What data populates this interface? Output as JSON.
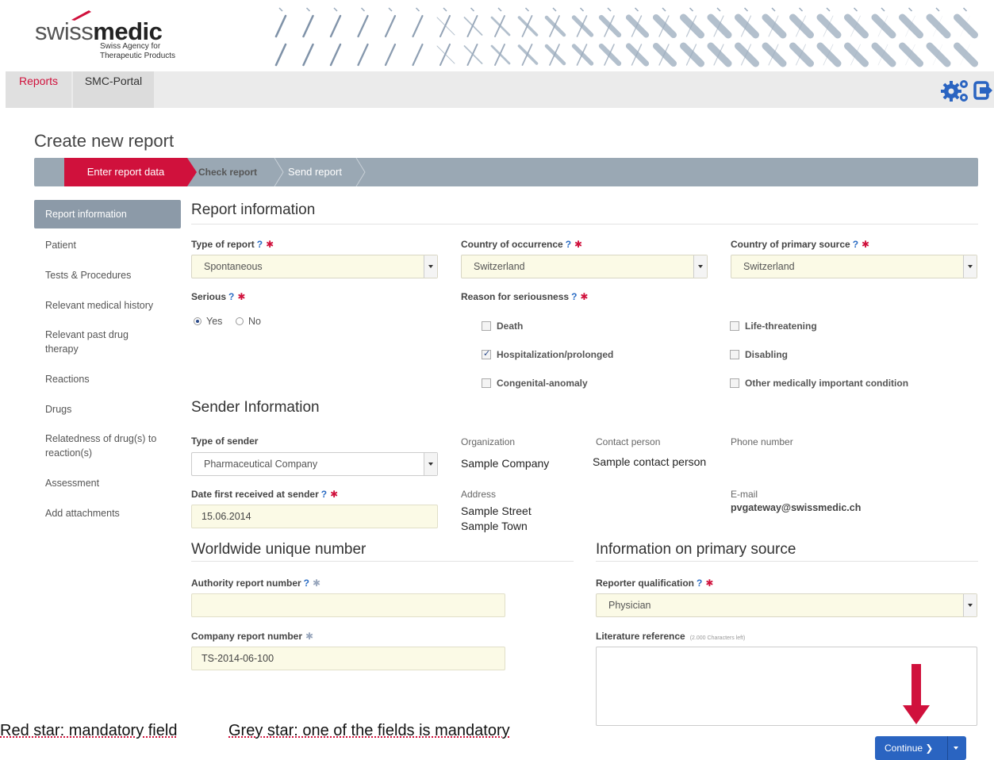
{
  "header": {
    "logo_swiss": "swiss",
    "logo_medic": "medic",
    "logo_sub1": "Swiss Agency for",
    "logo_sub2": "Therapeutic Products",
    "brand_color": "#d0113c"
  },
  "nav": {
    "tabs": [
      {
        "label": "Reports",
        "active": true
      },
      {
        "label": "SMC-Portal",
        "active": false
      }
    ],
    "icons": [
      "gears-icon",
      "logout-icon"
    ]
  },
  "page_title": "Create new report",
  "wizard": {
    "steps": [
      {
        "label": "Enter report data",
        "active": true
      },
      {
        "label": "Check report",
        "active": false
      },
      {
        "label": "Send report",
        "active": false
      }
    ]
  },
  "sidebar": {
    "items": [
      {
        "label": "Report information",
        "active": true
      },
      {
        "label": "Patient"
      },
      {
        "label": "Tests & Procedures"
      },
      {
        "label": "Relevant medical history"
      },
      {
        "label": "Relevant past drug therapy"
      },
      {
        "label": "Reactions"
      },
      {
        "label": "Drugs"
      },
      {
        "label": "Relatedness of drug(s) to reaction(s)"
      },
      {
        "label": "Assessment"
      },
      {
        "label": "Add attachments"
      }
    ]
  },
  "report_info": {
    "title": "Report information",
    "type_of_report_label": "Type of report",
    "type_of_report_value": "Spontaneous",
    "country_occurrence_label": "Country of occurrence",
    "country_occurrence_value": "Switzerland",
    "country_primary_label": "Country of primary source",
    "country_primary_value": "Switzerland",
    "serious_label": "Serious",
    "serious_yes": "Yes",
    "serious_no": "No",
    "serious_selected": "Yes",
    "reason_label": "Reason for seriousness",
    "reasons": [
      {
        "label": "Death",
        "checked": false
      },
      {
        "label": "Hospitalization/prolonged",
        "checked": true
      },
      {
        "label": "Congenital-anomaly",
        "checked": false
      },
      {
        "label": "Life-threatening",
        "checked": false
      },
      {
        "label": "Disabling",
        "checked": false
      },
      {
        "label": "Other medically important condition",
        "checked": false
      }
    ]
  },
  "sender": {
    "title": "Sender Information",
    "type_label": "Type of sender",
    "type_value": "Pharmaceutical Company",
    "org_label": "Organization",
    "org_value": "Sample Company",
    "contact_label": "Contact person",
    "contact_value": "Sample contact person",
    "phone_label": "Phone number",
    "date_label": "Date first received at sender",
    "date_value": "15.06.2014",
    "address_label": "Address",
    "address_line1": "Sample Street",
    "address_line2": "Sample Town",
    "email_label": "E-mail",
    "email_value": "pvgateway@swissmedic.ch"
  },
  "worldwide": {
    "title": "Worldwide unique number",
    "authority_label": "Authority report number",
    "authority_value": "",
    "company_label": "Company report number",
    "company_value": "TS-2014-06-100"
  },
  "primary_source": {
    "title": "Information on primary source",
    "qualification_label": "Reporter qualification",
    "qualification_value": "Physician",
    "literature_label": "Literature reference",
    "literature_hint": "(2.000 Characters left)"
  },
  "symbols": {
    "question": "?",
    "star": "✱"
  },
  "notes": {
    "red_star": "Red star: mandatory field",
    "grey_star": "Grey star: one of  the fields is mandatory"
  },
  "continue_label": "Continue"
}
